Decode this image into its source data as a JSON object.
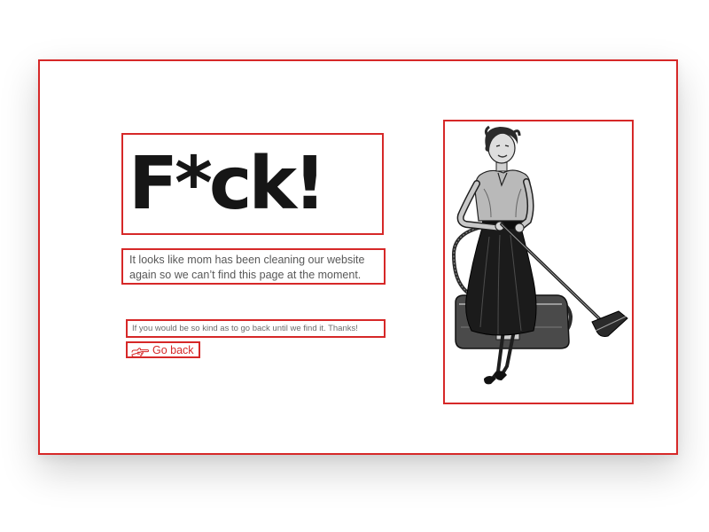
{
  "page": {
    "headline": "F*ck!",
    "message": "It looks like mom has been cleaning our website again so we can’t find this page at the moment.",
    "note": "If you would be so kind as to go back until we find it. Thanks!",
    "go_back_label": "Go back",
    "go_back_icon": "pointing-hand-icon",
    "illustration": "woman-with-vacuum-cleaner"
  },
  "colors": {
    "accent": "#d62828",
    "headline": "#161616",
    "body_text": "#585858"
  }
}
